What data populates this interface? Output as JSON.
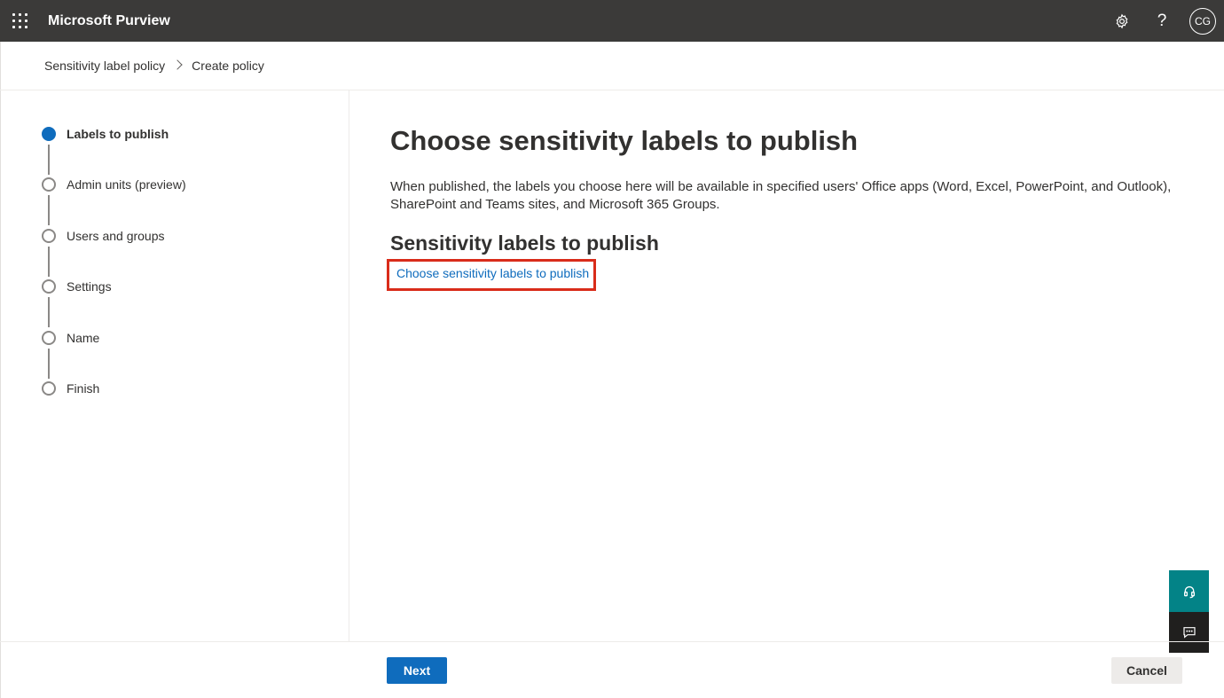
{
  "header": {
    "app_title": "Microsoft Purview",
    "icons": [
      "app-launcher-icon",
      "settings-gear-icon",
      "help-icon"
    ],
    "avatar_initials": "CG"
  },
  "breadcrumb": {
    "items": [
      "Sensitivity label policy",
      "Create policy"
    ]
  },
  "wizard": {
    "steps": [
      {
        "label": "Labels to publish",
        "active": true
      },
      {
        "label": "Admin units (preview)",
        "active": false
      },
      {
        "label": "Users and groups",
        "active": false
      },
      {
        "label": "Settings",
        "active": false
      },
      {
        "label": "Name",
        "active": false
      },
      {
        "label": "Finish",
        "active": false
      }
    ]
  },
  "main": {
    "title": "Choose sensitivity labels to publish",
    "description": "When published, the labels you choose here will be available in specified users' Office apps (Word, Excel, PowerPoint, and Outlook), SharePoint and Teams sites, and Microsoft 365 Groups.",
    "section_title": "Sensitivity labels to publish",
    "choose_link": "Choose sensitivity labels to publish"
  },
  "side_buttons": [
    "support-headset-icon",
    "feedback-chat-icon"
  ],
  "footer": {
    "next_label": "Next",
    "cancel_label": "Cancel"
  },
  "colors": {
    "topbar": "#3b3a39",
    "accent": "#0f6cbd",
    "highlight_box": "#d92c1a",
    "support_button": "#038387",
    "feedback_button": "#201f1e"
  }
}
